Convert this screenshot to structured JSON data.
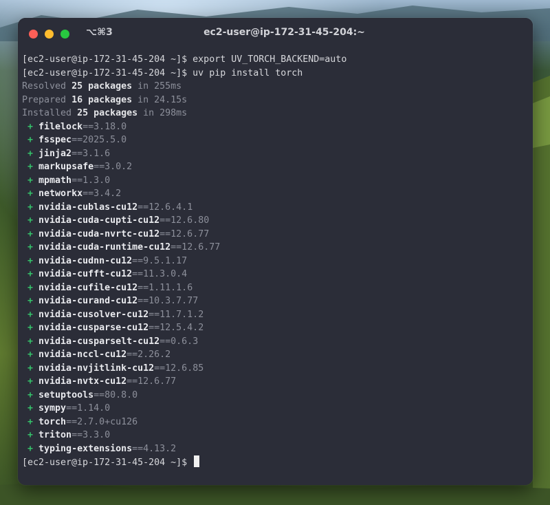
{
  "window": {
    "shortcut": "⌥⌘3",
    "title": "ec2-user@ip-172-31-45-204:~"
  },
  "terminal": {
    "commands": [
      {
        "prompt": "[ec2-user@ip-172-31-45-204 ~]$ ",
        "text": "export UV_TORCH_BACKEND=auto"
      },
      {
        "prompt": "[ec2-user@ip-172-31-45-204 ~]$ ",
        "text": "uv pip install torch"
      }
    ],
    "summary": [
      {
        "verb": "Resolved ",
        "count": "25 packages",
        "rest": " in 255ms"
      },
      {
        "verb": "Prepared ",
        "count": "16 packages",
        "rest": " in 24.15s"
      },
      {
        "verb": "Installed ",
        "count": "25 packages",
        "rest": " in 298ms"
      }
    ],
    "packages": [
      {
        "name": "filelock",
        "version": "==3.18.0"
      },
      {
        "name": "fsspec",
        "version": "==2025.5.0"
      },
      {
        "name": "jinja2",
        "version": "==3.1.6"
      },
      {
        "name": "markupsafe",
        "version": "==3.0.2"
      },
      {
        "name": "mpmath",
        "version": "==1.3.0"
      },
      {
        "name": "networkx",
        "version": "==3.4.2"
      },
      {
        "name": "nvidia-cublas-cu12",
        "version": "==12.6.4.1"
      },
      {
        "name": "nvidia-cuda-cupti-cu12",
        "version": "==12.6.80"
      },
      {
        "name": "nvidia-cuda-nvrtc-cu12",
        "version": "==12.6.77"
      },
      {
        "name": "nvidia-cuda-runtime-cu12",
        "version": "==12.6.77"
      },
      {
        "name": "nvidia-cudnn-cu12",
        "version": "==9.5.1.17"
      },
      {
        "name": "nvidia-cufft-cu12",
        "version": "==11.3.0.4"
      },
      {
        "name": "nvidia-cufile-cu12",
        "version": "==1.11.1.6"
      },
      {
        "name": "nvidia-curand-cu12",
        "version": "==10.3.7.77"
      },
      {
        "name": "nvidia-cusolver-cu12",
        "version": "==11.7.1.2"
      },
      {
        "name": "nvidia-cusparse-cu12",
        "version": "==12.5.4.2"
      },
      {
        "name": "nvidia-cusparselt-cu12",
        "version": "==0.6.3"
      },
      {
        "name": "nvidia-nccl-cu12",
        "version": "==2.26.2"
      },
      {
        "name": "nvidia-nvjitlink-cu12",
        "version": "==12.6.85"
      },
      {
        "name": "nvidia-nvtx-cu12",
        "version": "==12.6.77"
      },
      {
        "name": "setuptools",
        "version": "==80.8.0"
      },
      {
        "name": "sympy",
        "version": "==1.14.0"
      },
      {
        "name": "torch",
        "version": "==2.7.0+cu126"
      },
      {
        "name": "triton",
        "version": "==3.3.0"
      },
      {
        "name": "typing-extensions",
        "version": "==4.13.2"
      }
    ],
    "package_prefix": " + ",
    "final_prompt": "[ec2-user@ip-172-31-45-204 ~]$ "
  },
  "colors": {
    "window_bg": "#2b2d38",
    "plus_green": "#34c36a",
    "close": "#fe5f57",
    "minimize": "#febc2e",
    "zoom": "#28c840"
  },
  "icons": [
    "close-button",
    "minimize-button",
    "zoom-button"
  ]
}
